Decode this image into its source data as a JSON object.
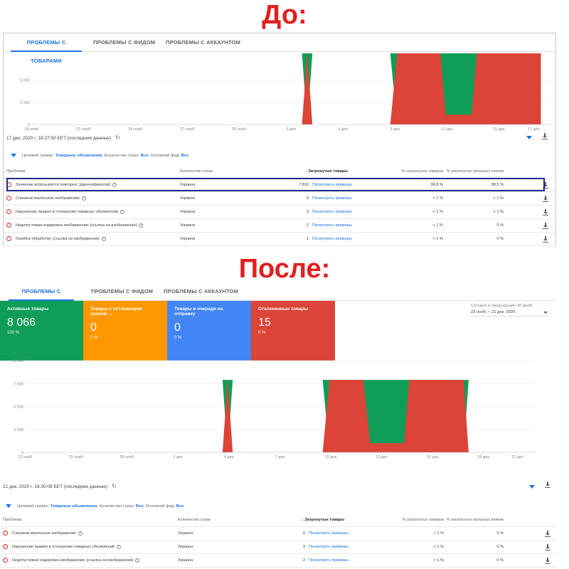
{
  "titles": {
    "before": "До:",
    "after": "После:"
  },
  "tabs": [
    "ПРОБЛЕМЫ С ТОВАРАМИ",
    "ПРОБЛЕМЫ С ФИДОМ",
    "ПРОБЛЕМЫ С АККАУНТОМ"
  ],
  "colors": {
    "green": "#0f9d58",
    "red": "#db4437",
    "orange": "#ff9800",
    "blue": "#4285f4",
    "accent": "#1a73e8"
  },
  "before": {
    "timestamp": "17 дек. 2020 г. 18:27:50 EET (последние данные)",
    "filter": {
      "prefix": "Целевой сервис:",
      "service": "Товарные объявления",
      "countries_label": "; Количество стран:",
      "countries": "Все",
      "feed_label": "; Основной фид:",
      "feed": "Все"
    },
    "table": {
      "headers": {
        "problem": "Проблема",
        "countries": "Количество стран",
        "affected": "Затронутые товары",
        "pct_affected": "% затронутых товаров",
        "pct_clicks": "% затронутых прошлых кликов"
      },
      "rows": [
        {
          "problem": "Значение используется повторно: [идентификатор]",
          "country": "Украина",
          "count": "7 816",
          "link": "Посмотреть примеры",
          "pct": "96,8 %",
          "clicks": "98,5 %"
        },
        {
          "problem": "Слишком маленькое изображение",
          "country": "Украина",
          "count": "9",
          "link": "Посмотреть примеры",
          "pct": "< 1 %",
          "clicks": "< 1 %"
        },
        {
          "problem": "Нарушение правил в отношении товарных объявлений",
          "country": "Украина",
          "count": "3",
          "link": "Посмотреть примеры",
          "pct": "< 1 %",
          "clicks": "< 1 %"
        },
        {
          "problem": "Недопустимая кодировка изображения: [ссылка на изображение]",
          "country": "Украина",
          "count": "2",
          "link": "Посмотреть примеры",
          "pct": "< 1 %",
          "clicks": "0 %"
        },
        {
          "problem": "Ошибка обработки: [ссылка на изображение]",
          "country": "Украина",
          "count": "1",
          "link": "Посмотреть примеры",
          "pct": "< 1 %",
          "clicks": "0 %"
        }
      ]
    }
  },
  "after": {
    "cards": [
      {
        "label": "Активные товары",
        "value": "8 066",
        "pct": "100 %"
      },
      {
        "label": "Товары с истекающим сроком ...",
        "value": "0",
        "pct": "0 %"
      },
      {
        "label": "Товары в очереди на отправку",
        "value": "0",
        "pct": "0 %"
      },
      {
        "label": "Отклоненные товары",
        "value": "15",
        "pct": "0 %"
      }
    ],
    "daterange": {
      "label": "Сегодня и предыдущие 30 дней",
      "value": "22 нояб. – 21 дек. 2020"
    },
    "timestamp": "21 дек. 2020 г. 16:30:09 EET (последние данные)",
    "filter": {
      "prefix": "Целевой сервис:",
      "service": "Товарные объявления",
      "countries_label": "; Количество стран:",
      "countries": "Все",
      "feed_label": "; Основной фид:",
      "feed": "Все"
    },
    "table": {
      "headers": {
        "problem": "Проблема",
        "countries": "Количество стран",
        "affected": "Затронутые товары",
        "pct_affected": "% затронутых товаров",
        "pct_clicks": "% затронутых прошлых кликов"
      },
      "rows": [
        {
          "problem": "Слишком маленькое изображение",
          "country": "Украина",
          "count": "9",
          "link": "Посмотреть примеры",
          "pct": "< 1 %",
          "clicks": "0 %"
        },
        {
          "problem": "Нарушение правил в отношении товарных объявлений",
          "country": "Украина",
          "count": "3",
          "link": "Посмотреть примеры",
          "pct": "< 1 %",
          "clicks": "0 %"
        },
        {
          "problem": "Недопустимая кодировка изображения: [ссылка на изображение]",
          "country": "Украина",
          "count": "2",
          "link": "Посмотреть примеры",
          "pct": "< 1 %",
          "clicks": "0 %"
        }
      ]
    }
  },
  "chart_data": [
    {
      "type": "area",
      "ylim": [
        0,
        8000
      ],
      "yticks": [
        "5 000",
        "2 500",
        "0"
      ],
      "yvals": [
        5000,
        2500,
        0
      ],
      "xlabels": [
        "18 нояб.",
        "21 нояб.",
        "24 нояб.",
        "27 нояб.",
        "30 нояб.",
        "3 дек.",
        "6 дек.",
        "9 дек.",
        "12 дек.",
        "15 дек.",
        "17 дек."
      ],
      "days": [
        0,
        3,
        6,
        9,
        12,
        15,
        18,
        21,
        24,
        27,
        29
      ],
      "series": [
        {
          "values": [
            [
              0,
              8000
            ],
            [
              15.6,
              8000
            ],
            [
              15.9,
              0
            ],
            [
              16.2,
              8000
            ],
            [
              20.7,
              8000
            ],
            [
              21.1,
              0
            ],
            [
              29.4,
              0
            ],
            [
              29.4,
              8000
            ]
          ]
        },
        {
          "values": [
            [
              15.6,
              0
            ],
            [
              15.9,
              8000
            ],
            [
              16.2,
              0
            ],
            [
              20.7,
              0
            ],
            [
              21.1,
              8000
            ],
            [
              23.6,
              8000
            ],
            [
              23.9,
              1100
            ],
            [
              25.4,
              1100
            ],
            [
              25.7,
              8000
            ],
            [
              29.4,
              8000
            ],
            [
              29.4,
              0
            ]
          ]
        }
      ]
    },
    {
      "type": "area",
      "ylim": [
        0,
        10000
      ],
      "yticks": [
        "10 000",
        "7 500",
        "5 000",
        "2 500",
        "0"
      ],
      "yvals": [
        10000,
        7500,
        5000,
        2500,
        0
      ],
      "xlabels": [
        "22 нояб.",
        "25 нояб.",
        "28 нояб.",
        "1 дек.",
        "4 дек.",
        "7 дек.",
        "10 дек.",
        "13 дек.",
        "16 дек.",
        "19 дек.",
        "21 дек."
      ],
      "days": [
        0,
        3,
        6,
        9,
        12,
        15,
        18,
        21,
        24,
        27,
        29
      ],
      "series": [
        {
          "values": [
            [
              0,
              7900
            ],
            [
              11.6,
              7900
            ],
            [
              11.9,
              0
            ],
            [
              12.2,
              7900
            ],
            [
              17.5,
              7900
            ],
            [
              17.9,
              0
            ],
            [
              25.8,
              0
            ],
            [
              26.1,
              7900
            ],
            [
              30,
              7900
            ]
          ]
        },
        {
          "values": [
            [
              11.6,
              0
            ],
            [
              11.9,
              7900
            ],
            [
              12.2,
              0
            ],
            [
              17.5,
              0
            ],
            [
              17.9,
              7900
            ],
            [
              19.9,
              7900
            ],
            [
              20.3,
              1000
            ],
            [
              22.3,
              1000
            ],
            [
              22.6,
              7900
            ],
            [
              25.8,
              7900
            ],
            [
              26.1,
              0
            ]
          ]
        }
      ]
    }
  ]
}
